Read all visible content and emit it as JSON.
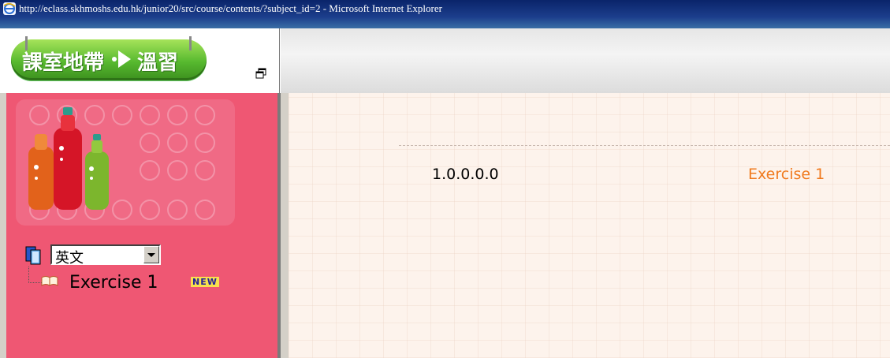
{
  "window": {
    "title": "http://eclass.skhmoshs.edu.hk/junior20/src/course/contents/?subject_id=2 - Microsoft Internet Explorer"
  },
  "header": {
    "logo_part1": "課室地帶",
    "logo_part2": "溫習"
  },
  "sidebar": {
    "subject_selected": "英文",
    "tree_items": [
      {
        "label": "Exercise 1",
        "badge": "NEW"
      }
    ]
  },
  "content": {
    "section_number": "1.0.0.0.0",
    "section_title": "Exercise 1"
  },
  "colors": {
    "sidebar_bg": "#ef5773",
    "content_title": "#f07a1e",
    "logo_green": "#57b92f"
  }
}
